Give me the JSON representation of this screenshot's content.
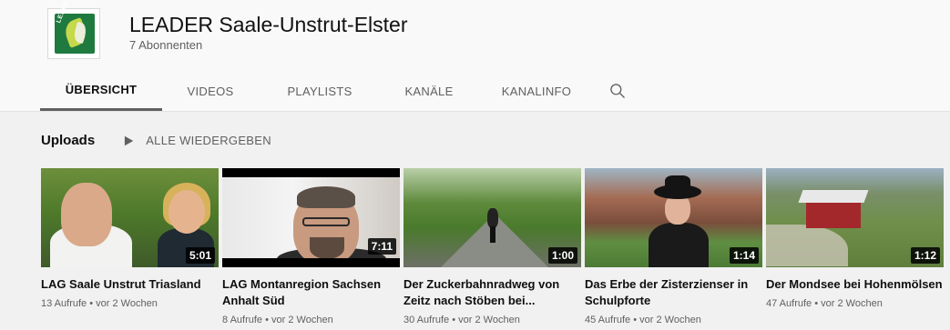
{
  "channel": {
    "name": "LEADER Saale-Unstrut-Elster",
    "subscribers": "7 Abonnenten",
    "logo_text": "LEADER"
  },
  "tabs": [
    "ÜBERSICHT",
    "VIDEOS",
    "PLAYLISTS",
    "KANÄLE",
    "KANALINFO"
  ],
  "active_tab": "ÜBERSICHT",
  "shelf": {
    "title": "Uploads",
    "play_all": "ALLE WIEDERGEBEN"
  },
  "videos": [
    {
      "title": "LAG Saale Unstrut Triasland",
      "duration": "5:01",
      "views": "13 Aufrufe",
      "age": "vor 2 Wochen"
    },
    {
      "title": "LAG Montanregion Sachsen Anhalt Süd",
      "duration": "7:11",
      "views": "8 Aufrufe",
      "age": "vor 2 Wochen"
    },
    {
      "title": "Der Zuckerbahnradweg von Zeitz nach Stöben bei...",
      "duration": "1:00",
      "views": "30 Aufrufe",
      "age": "vor 2 Wochen"
    },
    {
      "title": "Das Erbe der Zisterzienser in Schulpforte",
      "duration": "1:14",
      "views": "45 Aufrufe",
      "age": "vor 2 Wochen"
    },
    {
      "title": "Der Mondsee bei Hohenmölsen",
      "duration": "1:12",
      "views": "47 Aufrufe",
      "age": "vor 2 Wochen"
    }
  ],
  "meta_separator": "•",
  "icons": {
    "search": "search-icon",
    "play": "play-icon"
  }
}
